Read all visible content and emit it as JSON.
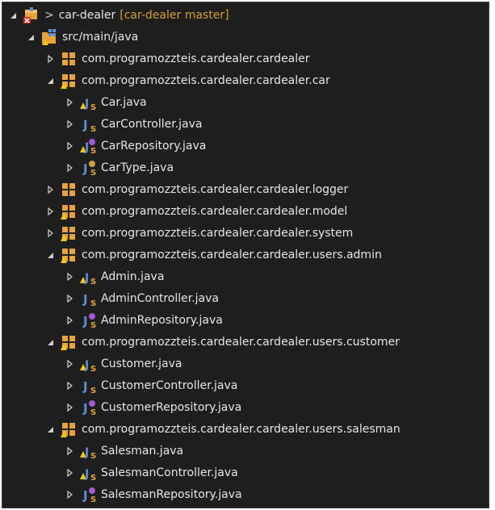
{
  "project": {
    "prefix": ">",
    "name": "car-dealer",
    "branch": "[car-dealer master]"
  },
  "source_folder": "src/main/java",
  "packages": [
    {
      "name": "com.programozzteis.cardealer.cardealer",
      "expanded": false,
      "icon": "package-icon",
      "files": []
    },
    {
      "name": "com.programozzteis.cardealer.cardealer.car",
      "expanded": true,
      "icon": "package-warning-icon",
      "files": [
        {
          "name": "Car.java",
          "icon": "class-warning-icon"
        },
        {
          "name": "CarController.java",
          "icon": "class-icon"
        },
        {
          "name": "CarRepository.java",
          "icon": "interface-warning-icon"
        },
        {
          "name": "CarType.java",
          "icon": "enum-icon"
        }
      ]
    },
    {
      "name": "com.programozzteis.cardealer.cardealer.logger",
      "expanded": false,
      "icon": "package-icon",
      "files": []
    },
    {
      "name": "com.programozzteis.cardealer.cardealer.model",
      "expanded": false,
      "icon": "package-warning-icon",
      "files": []
    },
    {
      "name": "com.programozzteis.cardealer.cardealer.system",
      "expanded": false,
      "icon": "package-warning-icon",
      "files": []
    },
    {
      "name": "com.programozzteis.cardealer.cardealer.users.admin",
      "expanded": true,
      "icon": "package-warning-icon",
      "files": [
        {
          "name": "Admin.java",
          "icon": "class-warning-icon"
        },
        {
          "name": "AdminController.java",
          "icon": "class-icon"
        },
        {
          "name": "AdminRepository.java",
          "icon": "interface-icon"
        }
      ]
    },
    {
      "name": "com.programozzteis.cardealer.cardealer.users.customer",
      "expanded": true,
      "icon": "package-warning-icon",
      "files": [
        {
          "name": "Customer.java",
          "icon": "class-warning-icon"
        },
        {
          "name": "CustomerController.java",
          "icon": "class-icon"
        },
        {
          "name": "CustomerRepository.java",
          "icon": "interface-icon"
        }
      ]
    },
    {
      "name": "com.programozzteis.cardealer.cardealer.users.salesman",
      "expanded": true,
      "icon": "package-warning-icon",
      "files": [
        {
          "name": "Salesman.java",
          "icon": "class-warning-icon"
        },
        {
          "name": "SalesmanController.java",
          "icon": "class-warning-icon"
        },
        {
          "name": "SalesmanRepository.java",
          "icon": "interface-icon"
        }
      ]
    }
  ],
  "colors": {
    "background": "#1e1e1e",
    "text": "#e6e6e6",
    "branch": "#d4a034",
    "package_orange": "#e8a33a",
    "java_blue": "#5b8fd8",
    "warning_yellow": "#f2c811",
    "interface_purple": "#a05bd6"
  }
}
